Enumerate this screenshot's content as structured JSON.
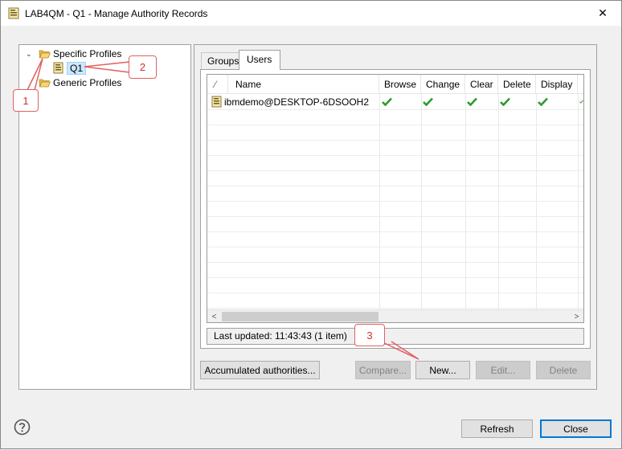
{
  "window": {
    "title": "LAB4QM - Q1 - Manage Authority Records",
    "close_glyph": "✕"
  },
  "tree": {
    "chevron_glyph": "⌄",
    "items": [
      {
        "label": "Specific Profiles",
        "icon": "folder-open-icon"
      },
      {
        "label": "Q1",
        "icon": "profile-icon",
        "selected": true
      },
      {
        "label": "Generic Profiles",
        "icon": "folder-open-icon"
      }
    ]
  },
  "tabs": [
    {
      "label": "Groups",
      "active": false
    },
    {
      "label": "Users",
      "active": true
    }
  ],
  "table": {
    "sort_glyph": "⁄",
    "columns": [
      "Name",
      "Browse",
      "Change",
      "Clear",
      "Delete",
      "Display"
    ],
    "rows": [
      {
        "name": "ibmdemo@DESKTOP-6DSOOH2",
        "checks": [
          true,
          true,
          true,
          true,
          true,
          true
        ]
      }
    ]
  },
  "scrollbar": {
    "left_glyph": "<",
    "right_glyph": ">"
  },
  "status": {
    "text": "Last updated: 11:43:43 (1 item)"
  },
  "buttons": {
    "accumulated": "Accumulated authorities...",
    "compare": "Compare...",
    "new": "New...",
    "edit": "Edit...",
    "delete": "Delete",
    "refresh": "Refresh",
    "close": "Close"
  },
  "annotations": [
    "1",
    "2",
    "3"
  ],
  "colors": {
    "accent": "#0078d7",
    "selection": "#cce8ff",
    "annotation": "#e06060",
    "check": "#2e9a2e",
    "folder": "#e8b94a"
  }
}
